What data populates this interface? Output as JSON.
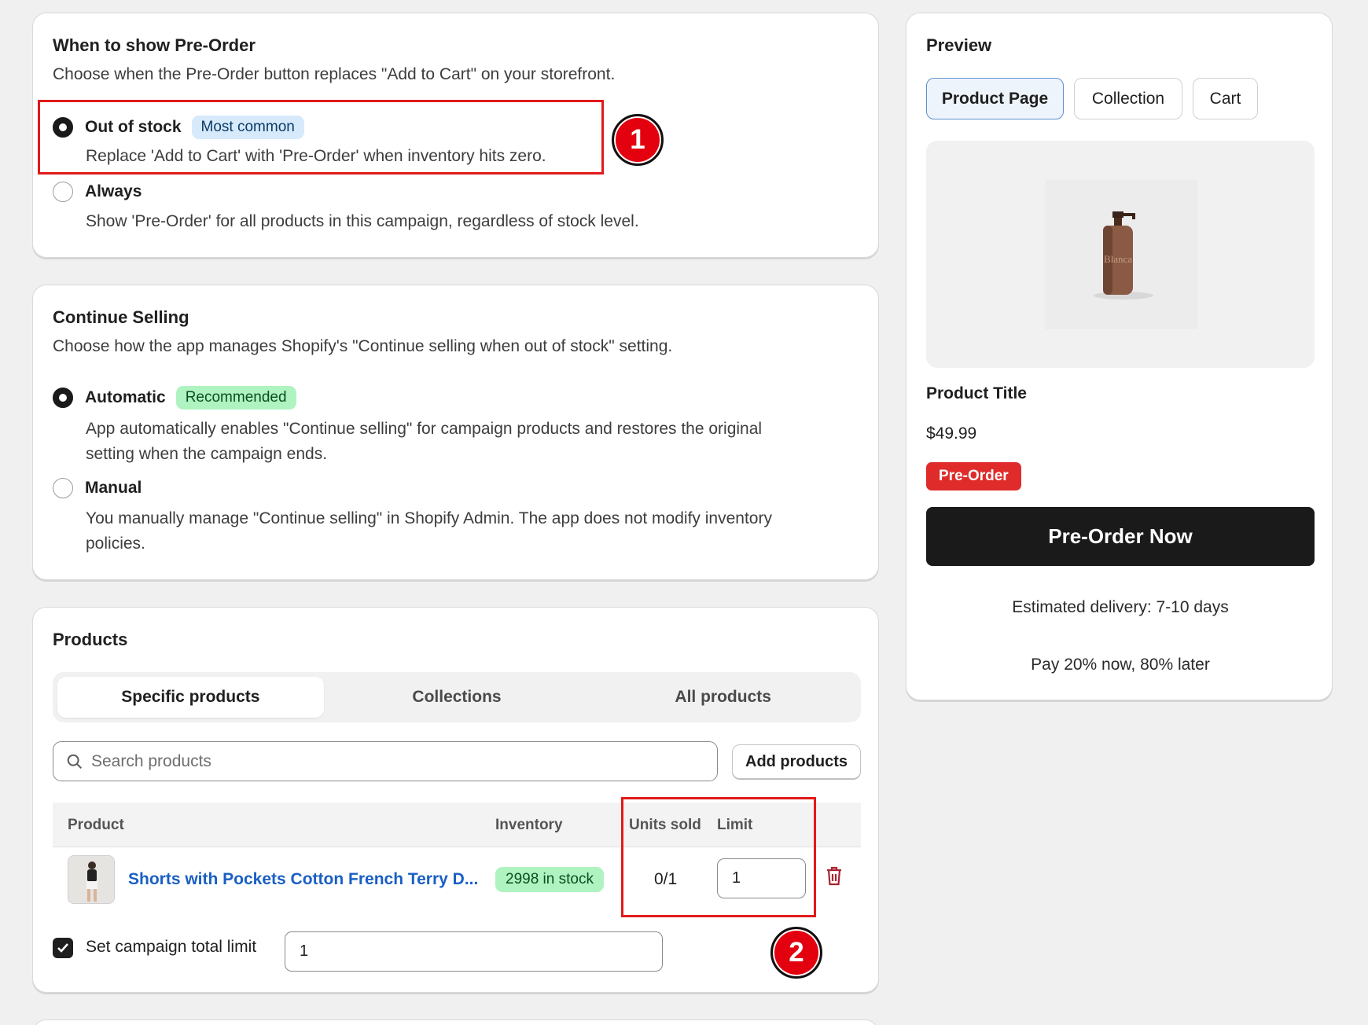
{
  "when_card": {
    "title": "When to show Pre-Order",
    "description": "Choose when the Pre-Order button replaces \"Add to Cart\" on your storefront.",
    "options": [
      {
        "label": "Out of stock",
        "badge": "Most common",
        "help": "Replace 'Add to Cart' with 'Pre-Order' when inventory hits zero.",
        "selected": true
      },
      {
        "label": "Always",
        "help": "Show 'Pre-Order' for all products in this campaign, regardless of stock level.",
        "selected": false
      }
    ]
  },
  "continue_card": {
    "title": "Continue Selling",
    "description": "Choose how the app manages Shopify's \"Continue selling when out of stock\" setting.",
    "options": [
      {
        "label": "Automatic",
        "badge": "Recommended",
        "help_line1": "App automatically enables \"Continue selling\" for campaign products and restores the original",
        "help_line2": "setting when the campaign ends.",
        "selected": true
      },
      {
        "label": "Manual",
        "help_line1": "You manually manage \"Continue selling\" in Shopify Admin. The app does not modify inventory",
        "help_line2": "policies.",
        "selected": false
      }
    ]
  },
  "products_card": {
    "title": "Products",
    "tabs": [
      "Specific products",
      "Collections",
      "All products"
    ],
    "active_tab": "Specific products",
    "search_placeholder": "Search products",
    "add_button": "Add products",
    "columns": [
      "Product",
      "Inventory",
      "Units sold",
      "Limit"
    ],
    "rows": [
      {
        "name": "Shorts with Pockets Cotton French Terry D...",
        "inventory": "2998 in stock",
        "units_sold": "0/1",
        "limit": "1"
      }
    ],
    "total_limit_label": "Set campaign total limit",
    "total_limit_checked": true,
    "total_limit_value": "1"
  },
  "preview": {
    "title": "Preview",
    "tabs": [
      "Product Page",
      "Collection",
      "Cart"
    ],
    "active_tab": "Product Page",
    "product_title": "Product Title",
    "price": "$49.99",
    "badge": "Pre-Order",
    "button": "Pre-Order Now",
    "delivery": "Estimated delivery: 7-10 days",
    "payment": "Pay 20% now, 80% later",
    "product_image_text": "Blanca"
  },
  "annotations": [
    "1",
    "2"
  ],
  "colors": {
    "accent_link": "#1a5fc4",
    "preorder_red": "#e02b2b",
    "annotation_red": "#e3000f",
    "stock_green": "#aff3c0"
  }
}
